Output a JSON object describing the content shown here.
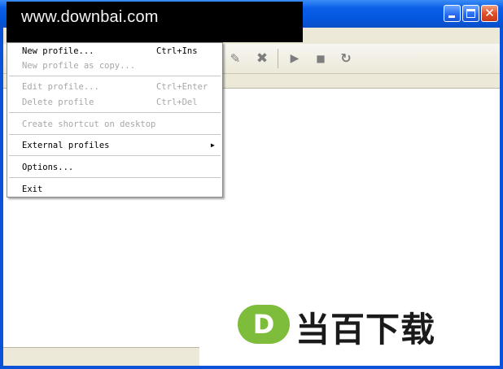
{
  "watermark": {
    "top_text": "www.downbai.com",
    "bottom_logo_letter": "D",
    "bottom_text": "当百下载"
  },
  "caption_buttons": {
    "close_glyph": "✕"
  },
  "toolbar": {
    "edit_icon": "pencil-icon",
    "edit_glyph": "✎",
    "delete_icon": "x-icon",
    "delete_glyph": "✖",
    "play_icon": "play-icon",
    "play_glyph": "▶",
    "stop_icon": "stop-icon",
    "stop_glyph": "■",
    "refresh_icon": "refresh-icon",
    "refresh_glyph": "↻"
  },
  "menu": {
    "items": [
      {
        "label": "New profile...",
        "accel": "Ctrl+Ins",
        "enabled": true
      },
      {
        "label": "New profile as copy...",
        "accel": "",
        "enabled": false
      },
      {
        "label": "Edit profile...",
        "accel": "Ctrl+Enter",
        "enabled": false
      },
      {
        "label": "Delete profile",
        "accel": "Ctrl+Del",
        "enabled": false
      },
      {
        "label": "Create shortcut on desktop",
        "accel": "",
        "enabled": false
      },
      {
        "label": "External profiles",
        "accel": "",
        "enabled": true,
        "submenu_glyph": "▶"
      },
      {
        "label": "Options...",
        "accel": "",
        "enabled": true
      },
      {
        "label": "Exit",
        "accel": "",
        "enabled": true
      }
    ]
  }
}
